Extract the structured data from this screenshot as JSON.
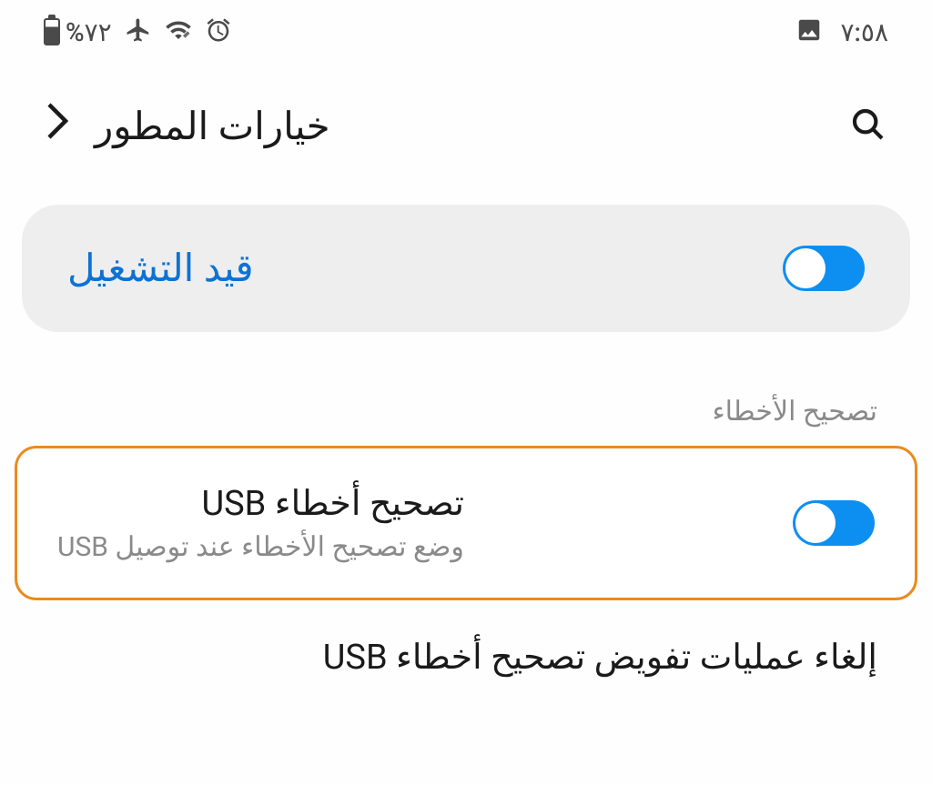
{
  "status_bar": {
    "battery_percent": "%٧٢",
    "clock": "٧:٥٨"
  },
  "header": {
    "title": "خيارات المطور"
  },
  "master_toggle": {
    "label": "قيد التشغيل"
  },
  "section": {
    "title": "تصحيح الأخطاء"
  },
  "usb_debugging": {
    "title": "تصحيح أخطاء USB",
    "subtitle": "وضع تصحيح الأخطاء عند توصيل USB"
  },
  "revoke_usb": {
    "title": "إلغاء عمليات تفويض تصحيح أخطاء USB"
  }
}
